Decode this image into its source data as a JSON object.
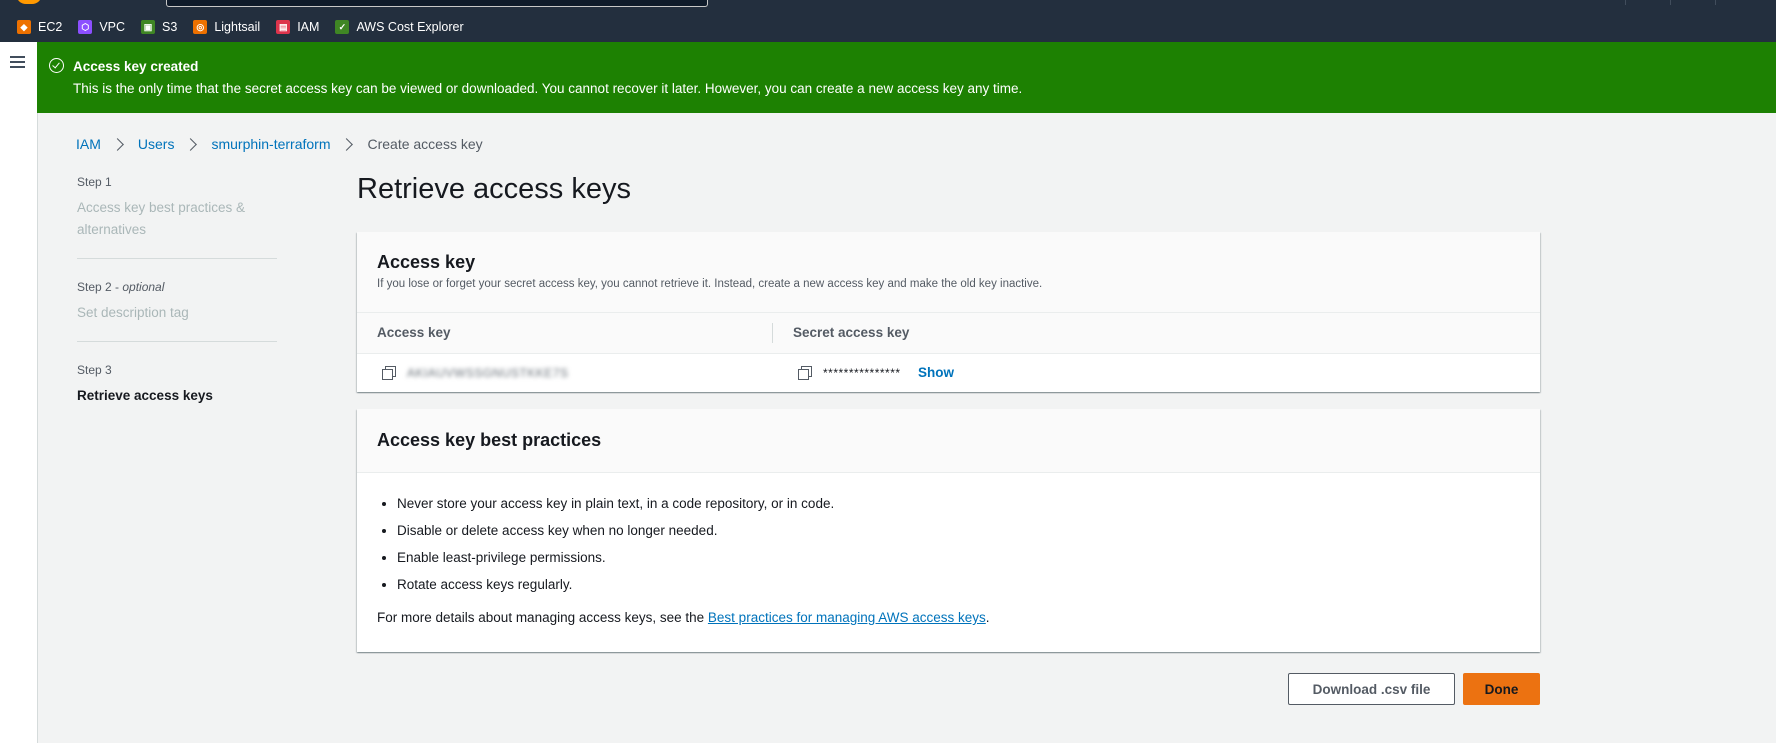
{
  "favorites": [
    {
      "label": "EC2",
      "icon": "ec2-icon",
      "color": "#ed7100"
    },
    {
      "label": "VPC",
      "icon": "vpc-icon",
      "color": "#8c4fff"
    },
    {
      "label": "S3",
      "icon": "s3-icon",
      "color": "#3f8624"
    },
    {
      "label": "Lightsail",
      "icon": "lightsail-icon",
      "color": "#ed7100"
    },
    {
      "label": "IAM",
      "icon": "iam-icon",
      "color": "#dd344c"
    },
    {
      "label": "AWS Cost Explorer",
      "icon": "cost-explorer-icon",
      "color": "#3f8624"
    }
  ],
  "flash": {
    "title": "Access key created",
    "message": "This is the only time that the secret access key can be viewed or downloaded. You cannot recover it later. However, you can create a new access key any time.",
    "color": "#1d8102"
  },
  "breadcrumb": {
    "items": [
      "IAM",
      "Users",
      "smurphin-terraform"
    ],
    "current": "Create access key"
  },
  "steps": [
    {
      "label": "Step 1",
      "optional": "",
      "desc": "Access key best practices & alternatives"
    },
    {
      "label": "Step 2 - ",
      "optional": "optional",
      "desc": "Set description tag"
    },
    {
      "label": "Step 3",
      "optional": "",
      "desc": "Retrieve access keys"
    }
  ],
  "page_title": "Retrieve access keys",
  "access_key_panel": {
    "title": "Access key",
    "description": "If you lose or forget your secret access key, you cannot retrieve it. Instead, create a new access key and make the old key inactive.",
    "col_access_key": "Access key",
    "col_secret_key": "Secret access key",
    "access_key_value": "AKIAUVWSSGNUSTKKE7S",
    "secret_masked": "***************",
    "show_label": "Show"
  },
  "best_practices": {
    "title": "Access key best practices",
    "items": [
      "Never store your access key in plain text, in a code repository, or in code.",
      "Disable or delete access key when no longer needed.",
      "Enable least-privilege permissions.",
      "Rotate access keys regularly."
    ],
    "more_prefix": "For more details about managing access keys, see the ",
    "more_link": "Best practices for managing AWS access keys",
    "more_suffix": "."
  },
  "buttons": {
    "download": "Download .csv file",
    "done": "Done"
  },
  "colors": {
    "topnav": "#232f3e",
    "primary": "#ec7211",
    "link": "#0073bb"
  }
}
